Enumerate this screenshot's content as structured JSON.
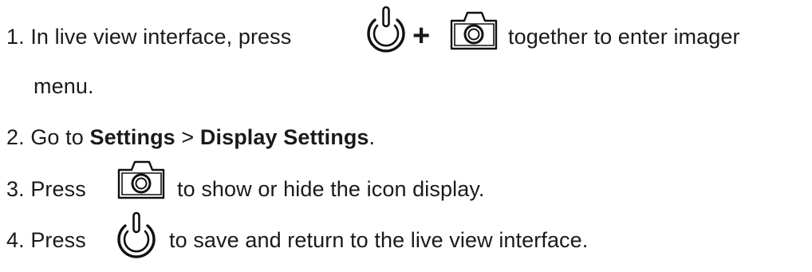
{
  "steps": [
    {
      "number": "1.",
      "text_before": "In live view interface, press",
      "plus": "+",
      "text_after": "together to enter imager",
      "continuation": "menu.",
      "icons": [
        "power-icon",
        "camera-icon"
      ]
    },
    {
      "number": "2.",
      "text_before": "Go to",
      "bold_1": "Settings",
      "separator": ">",
      "bold_2": "Display Settings",
      "end": "."
    },
    {
      "number": "3.",
      "text_before": "Press",
      "text_after": "to show or hide the icon display.",
      "icons": [
        "camera-icon"
      ]
    },
    {
      "number": "4.",
      "text_before": "Press",
      "text_after": "to save and return to the live view interface.",
      "icons": [
        "power-icon"
      ]
    }
  ]
}
